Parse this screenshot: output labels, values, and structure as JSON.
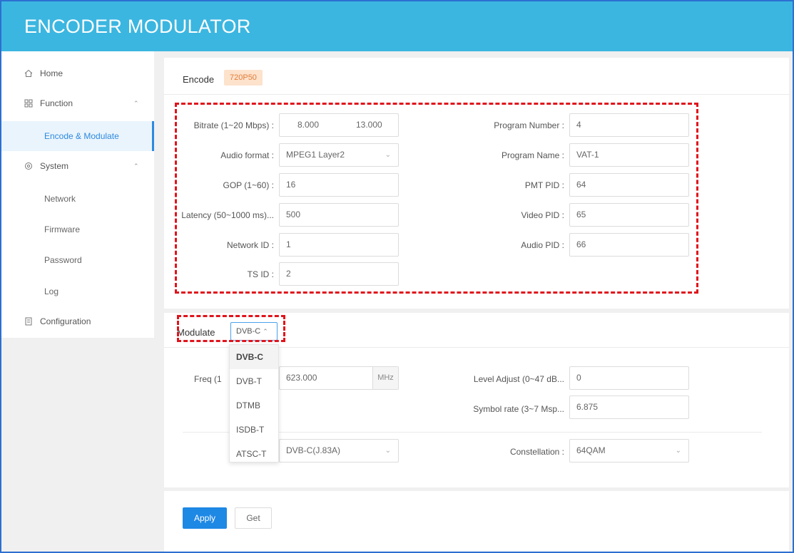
{
  "app": {
    "title": "ENCODER MODULATOR"
  },
  "sidebar": {
    "home": "Home",
    "function": "Function",
    "encode_modulate": "Encode & Modulate",
    "system": "System",
    "network": "Network",
    "firmware": "Firmware",
    "password": "Password",
    "log": "Log",
    "configuration": "Configuration"
  },
  "encode": {
    "title": "Encode",
    "badge": "720P50",
    "bitrate_label": "Bitrate (1~20 Mbps) :",
    "bitrate_value": "8.000",
    "bitrate_value2": "13.000",
    "audio_format_label": "Audio format :",
    "audio_format_value": "MPEG1 Layer2",
    "gop_label": "GOP (1~60) :",
    "gop_value": "16",
    "latency_label": "Latency (50~1000 ms)...",
    "latency_value": "500",
    "network_id_label": "Network ID :",
    "network_id_value": "1",
    "ts_id_label": "TS ID :",
    "ts_id_value": "2",
    "program_number_label": "Program Number :",
    "program_number_value": "4",
    "program_name_label": "Program Name :",
    "program_name_value": "VAT-1",
    "pmt_pid_label": "PMT PID :",
    "pmt_pid_value": "64",
    "video_pid_label": "Video PID :",
    "video_pid_value": "65",
    "audio_pid_label": "Audio PID :",
    "audio_pid_value": "66"
  },
  "modulate": {
    "title": "Modulate",
    "standard_value": "DVB-C",
    "options": [
      "DVB-C",
      "DVB-T",
      "DTMB",
      "ISDB-T",
      "ATSC-T"
    ],
    "freq_label": "Freq (1",
    "freq_value": "623.000",
    "freq_unit": "MHz",
    "level_label": "Level Adjust (0~47 dB...",
    "level_value": "0",
    "symbol_label": "Symbol rate (3~7 Msp...",
    "symbol_value": "6.875",
    "annex_value": "DVB-C(J.83A)",
    "constellation_label": "Constellation :",
    "constellation_value": "64QAM"
  },
  "actions": {
    "apply": "Apply",
    "get": "Get"
  },
  "colors": {
    "header": "#3bb6e0",
    "accent": "#1e88e5",
    "highlight": "#e0141c"
  }
}
